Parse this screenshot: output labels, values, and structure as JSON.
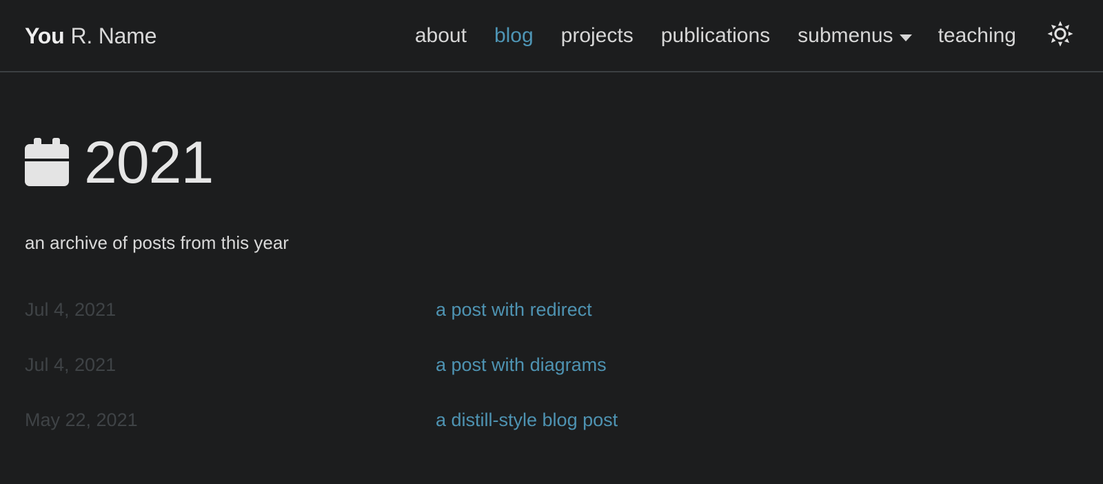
{
  "theme": {
    "background": "#1c1d1e",
    "text": "#e6e6e6",
    "muted_text": "#3f4346",
    "accent": "#4e93b2",
    "border": "#3c4042"
  },
  "navbar": {
    "brand": {
      "strong": "You",
      "rest": "R. Name"
    },
    "links": [
      {
        "label": "about",
        "active": false
      },
      {
        "label": "blog",
        "active": true
      },
      {
        "label": "projects",
        "active": false
      },
      {
        "label": "publications",
        "active": false
      }
    ],
    "dropdown": {
      "label": "submenus",
      "icon": "chevron-down-icon"
    },
    "trailing_links": [
      {
        "label": "teaching",
        "active": false
      }
    ],
    "theme_toggle": {
      "icon": "sun-icon",
      "title": "Change theme"
    }
  },
  "page": {
    "icon": "calendar-icon",
    "title": "2021",
    "subtitle": "an archive of posts from this year"
  },
  "posts": [
    {
      "date": "Jul 4, 2021",
      "title": "a post with redirect"
    },
    {
      "date": "Jul 4, 2021",
      "title": "a post with diagrams"
    },
    {
      "date": "May 22, 2021",
      "title": "a distill-style blog post"
    }
  ]
}
